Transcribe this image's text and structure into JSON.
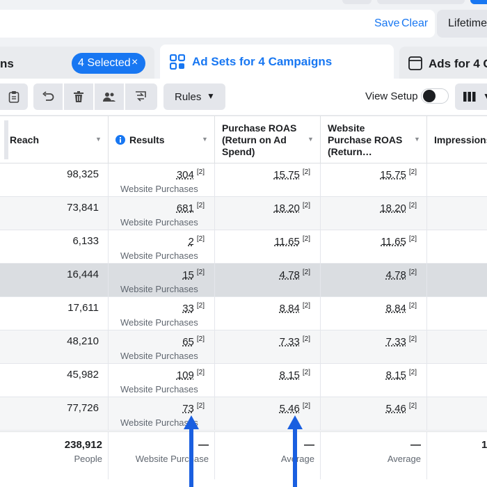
{
  "filter": {
    "save": "Save",
    "clear": "Clear",
    "date_label": "Lifetime:"
  },
  "tabs": {
    "left_partial": "ns",
    "selected_pill": "4 Selected",
    "selected_close": "×",
    "active": "Ad Sets for 4 Campaigns",
    "right_partial": "Ads for 4 C"
  },
  "toolbar": {
    "rules_label": "Rules",
    "view_setup_label": "View Setup",
    "view_setup_on": false
  },
  "icons": {
    "ad_sets_tab": "grid-icon",
    "ads_tab": "ad-window-icon",
    "buttons": [
      "clipboard-icon",
      "undo-icon",
      "trash-icon",
      "people-icon",
      "swap-icon"
    ],
    "columns": "columns-icon"
  },
  "columns": {
    "reach": "Reach",
    "results": "Results",
    "purchase_roas": "Purchase ROAS (Return on Ad Spend)",
    "website_roas": "Website Purchase ROAS (Return…",
    "impressions": "Impressions"
  },
  "rows": [
    {
      "reach": "98,325",
      "results": "304",
      "results_type": "Website Purchases",
      "purchase_roas": "15.75",
      "website_roas": "15.75",
      "note": "[2]"
    },
    {
      "reach": "73,841",
      "results": "681",
      "results_type": "Website Purchases",
      "purchase_roas": "18.20",
      "website_roas": "18.20",
      "note": "[2]"
    },
    {
      "reach": "6,133",
      "results": "2",
      "results_type": "Website Purchases",
      "purchase_roas": "11.65",
      "website_roas": "11.65",
      "note": "[2]"
    },
    {
      "reach": "16,444",
      "results": "15",
      "results_type": "Website Purchases",
      "purchase_roas": "4.78",
      "website_roas": "4.78",
      "note": "[2]"
    },
    {
      "reach": "17,611",
      "results": "33",
      "results_type": "Website Purchases",
      "purchase_roas": "8.84",
      "website_roas": "8.84",
      "note": "[2]"
    },
    {
      "reach": "48,210",
      "results": "65",
      "results_type": "Website Purchases",
      "purchase_roas": "7.33",
      "website_roas": "7.33",
      "note": "[2]"
    },
    {
      "reach": "45,982",
      "results": "109",
      "results_type": "Website Purchases",
      "purchase_roas": "8.15",
      "website_roas": "8.15",
      "note": "[2]"
    },
    {
      "reach": "77,726",
      "results": "73",
      "results_type": "Website Purchases",
      "purchase_roas": "5.46",
      "website_roas": "5.46",
      "note": "[2]"
    }
  ],
  "totals": {
    "reach": "238,912",
    "reach_sub": "People",
    "results": "—",
    "results_sub": "Website Purchase",
    "purchase_roas": "—",
    "purchase_roas_sub": "Average",
    "website_roas": "—",
    "website_roas_sub": "Average",
    "impressions": "1"
  },
  "colors": {
    "accent": "#1877f2",
    "highlight_row": "#dadde1",
    "annotation_arrow": "#1a5fe0"
  }
}
